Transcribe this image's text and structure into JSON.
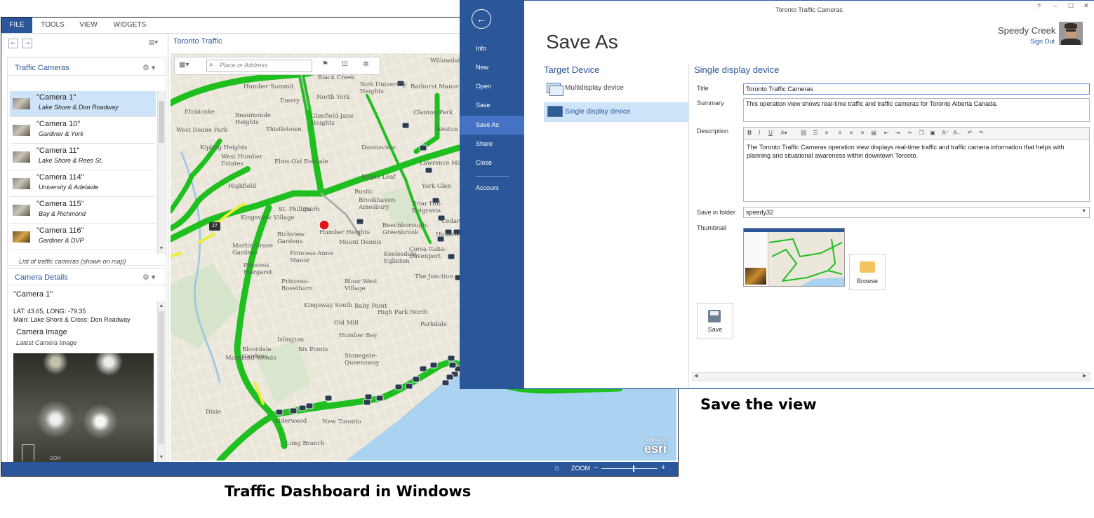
{
  "dashboard": {
    "menu": [
      "FILE",
      "TOOLS",
      "VIEW",
      "WIDGETS"
    ],
    "map_title": "Toronto Traffic",
    "search_placeholder": "Place or Address",
    "cameras_panel": {
      "title": "Traffic Cameras",
      "items": [
        {
          "name": "\"Camera 1\"",
          "location": "Lake Shore & Don Roadway"
        },
        {
          "name": "\"Camera 10\"",
          "location": "Gardiner & York"
        },
        {
          "name": "\"Camera 11\"",
          "location": "Lake Shore & Rees St."
        },
        {
          "name": "\"Camera 114\"",
          "location": "University & Adelaide"
        },
        {
          "name": "\"Camera 115\"",
          "location": "Bay & Richmond"
        },
        {
          "name": "\"Camera 116\"",
          "location": "Gardiner & DVP"
        }
      ],
      "footer": "List of traffic cameras (shown on map)"
    },
    "details_panel": {
      "title": "Camera Details",
      "camera": "\"Camera 1\"",
      "coords": "LAT: 43.65, LONG: -79.35",
      "main": "Main: Lake Shore & Cross: Don Roadway",
      "image_title": "Camera Image",
      "image_subtitle": "Latest Camera Image",
      "image_watermark": "DON"
    },
    "map_labels": [
      "Black Creek",
      "North York",
      "Willowdale",
      "Humber Summit",
      "York University Heights",
      "Bathurst Manor",
      "Emery",
      "Etobicoke",
      "Glenfield-Jane Heights",
      "Clanton Park",
      "Weston",
      "Beaumonde Heights",
      "Thistletown",
      "Downsview",
      "Lawrence Manor",
      "Kipling Heights",
      "West Humber Estates",
      "Elms-Old Rexdale",
      "York Glen",
      "Highfield",
      "Maple Leaf",
      "Rustic",
      "Brookhaven-Amesbury",
      "Briar Hill-Belgravia",
      "Cedarvale",
      "St. Phillips",
      "Fairh",
      "Kingsview Village",
      "Richview Gardens",
      "Humber Heights",
      "Beechborough-Greenbrook",
      "Humewood",
      "Mount Dennis",
      "Martin Grove Gardens",
      "Princess-Anne Manor",
      "Keelesdale-Eglinton",
      "Princess Margaret",
      "Corsa Italia-Davenport",
      "Princess-Rosethorn",
      "Bloor West Village",
      "The Junction",
      "Kingsway South",
      "Baby Point",
      "High Park North",
      "Old Mill",
      "Parkdale",
      "Islington",
      "Humber Bay",
      "Bloordale Gardens",
      "Six Points",
      "Markland Woods",
      "Stonegate-Queensway",
      "Dixie",
      "Alderwood",
      "New Toronto",
      "Long Branch",
      "West Deane Park"
    ],
    "highway_shield": "27",
    "esri_top": "POWERED BY",
    "esri_logo": "esri",
    "zoom_label": "ZOOM",
    "zoom_minus": "−",
    "zoom_plus": "+",
    "zoom_level": 0.58
  },
  "save_as": {
    "window_title": "Toronto Traffic Cameras",
    "heading": "Save As",
    "nav": [
      "Info",
      "New",
      "Open",
      "Save",
      "Save As",
      "Share",
      "Close",
      "Account"
    ],
    "nav_active": "Save As",
    "user_name": "Speedy Creek",
    "sign_out": "Sign Out",
    "target_device_title": "Target Device",
    "target_options": [
      "Multidisplay device",
      "Single display device"
    ],
    "selected_target": "Single display device",
    "form_title": "Single display device",
    "labels": {
      "title": "Title",
      "summary": "Summary",
      "description": "Description",
      "folder": "Save in folder",
      "thumbnail": "Thumbnail"
    },
    "values": {
      "title": "Toronto Traffic Cameras",
      "summary": "This operation view shows real-time traffic and traffic cameras for Toronto Alberta Canada.",
      "description": "The Toronto Traffic Cameras operation view displays real-time traffic and traffic camera information that helps with planning and situational awareness within downtown Toronto.",
      "folder": "speedy32"
    },
    "browse_label": "Browse",
    "save_label": "Save",
    "window_controls": [
      "?",
      "–",
      "☐",
      "✕"
    ]
  },
  "captions": {
    "left": "Traffic Dashboard in Windows",
    "right": "Save the view"
  },
  "colors": {
    "accent": "#2b579a",
    "traffic_green": "#1fbf1f",
    "traffic_yellow": "#ecec3a",
    "incident_red": "#e0141b"
  }
}
